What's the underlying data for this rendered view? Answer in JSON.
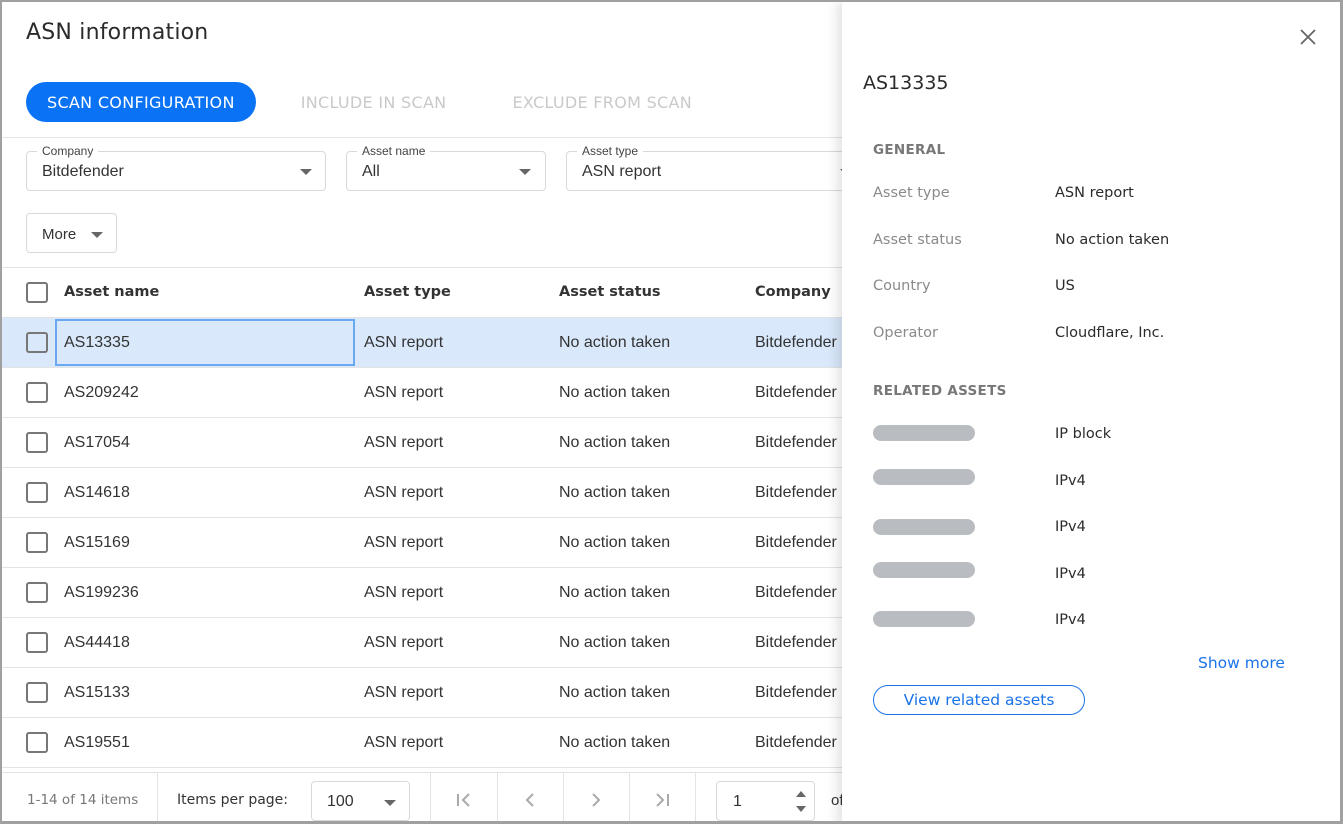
{
  "header": {
    "title": "ASN information"
  },
  "tabs": [
    {
      "label": "SCAN CONFIGURATION",
      "active": true
    },
    {
      "label": "INCLUDE IN SCAN",
      "active": false
    },
    {
      "label": "EXCLUDE FROM SCAN",
      "active": false
    }
  ],
  "filters": {
    "company": {
      "label": "Company",
      "value": "Bitdefender"
    },
    "asset_name": {
      "label": "Asset name",
      "value": "All"
    },
    "asset_type": {
      "label": "Asset type",
      "value": "ASN report"
    },
    "more_label": "More"
  },
  "table": {
    "columns": [
      "Asset name",
      "Asset type",
      "Asset status",
      "Company"
    ],
    "rows": [
      {
        "name": "AS13335",
        "type": "ASN report",
        "status": "No action taken",
        "company": "Bitdefender",
        "selected": true
      },
      {
        "name": "AS209242",
        "type": "ASN report",
        "status": "No action taken",
        "company": "Bitdefender"
      },
      {
        "name": "AS17054",
        "type": "ASN report",
        "status": "No action taken",
        "company": "Bitdefender"
      },
      {
        "name": "AS14618",
        "type": "ASN report",
        "status": "No action taken",
        "company": "Bitdefender"
      },
      {
        "name": "AS15169",
        "type": "ASN report",
        "status": "No action taken",
        "company": "Bitdefender"
      },
      {
        "name": "AS199236",
        "type": "ASN report",
        "status": "No action taken",
        "company": "Bitdefender"
      },
      {
        "name": "AS44418",
        "type": "ASN report",
        "status": "No action taken",
        "company": "Bitdefender"
      },
      {
        "name": "AS15133",
        "type": "ASN report",
        "status": "No action taken",
        "company": "Bitdefender"
      },
      {
        "name": "AS19551",
        "type": "ASN report",
        "status": "No action taken",
        "company": "Bitdefender"
      }
    ]
  },
  "pagination": {
    "range_text": "1-14 of 14 items",
    "items_per_page_label": "Items per page:",
    "items_per_page": "100",
    "current_page": "1",
    "of_label": "of"
  },
  "details": {
    "title": "AS13335",
    "general_heading": "GENERAL",
    "fields": [
      {
        "key": "Asset type",
        "value": "ASN report"
      },
      {
        "key": "Asset status",
        "value": "No action taken"
      },
      {
        "key": "Country",
        "value": "US"
      },
      {
        "key": "Operator",
        "value": "Cloudflare, Inc."
      }
    ],
    "related_heading": "RELATED ASSETS",
    "related": [
      {
        "type": "IP block"
      },
      {
        "type": "IPv4"
      },
      {
        "type": "IPv4"
      },
      {
        "type": "IPv4"
      },
      {
        "type": "IPv4"
      }
    ],
    "show_more_label": "Show more",
    "view_related_label": "View related assets"
  },
  "colors": {
    "accent": "#0a73f5",
    "link": "#1a73e8",
    "selected_row": "#d9e8fb"
  }
}
